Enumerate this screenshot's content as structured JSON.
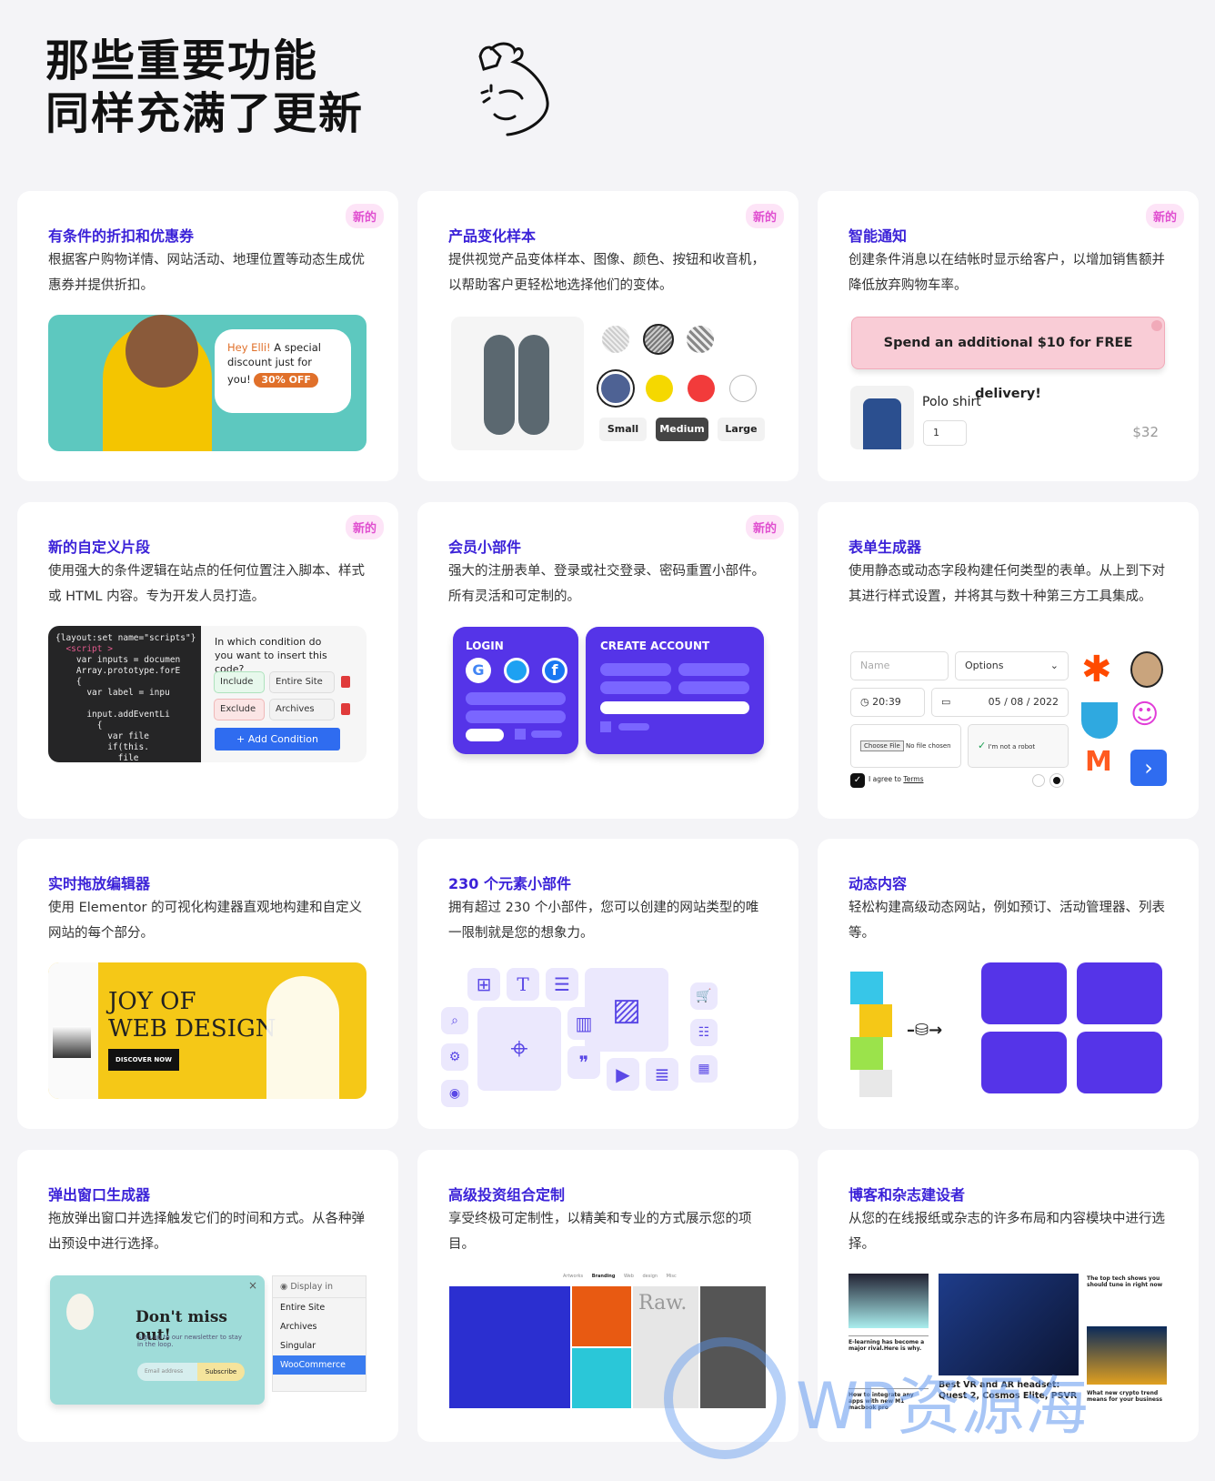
{
  "hero": {
    "line1": "那些重要功能",
    "line2": "同样充满了更新",
    "icon": "flexed-biceps-icon"
  },
  "badge_label": "新的",
  "colors": {
    "accent": "#3b22d8",
    "badge": "#e04fd0",
    "widget_purple": "#5534e8",
    "background": "#f4f4f7"
  },
  "cards": [
    {
      "title": "有条件的折扣和优惠券",
      "desc": "根据客户购物详情、网站活动、地理位置等动态生成优惠券并提供折扣。",
      "new": true,
      "bubble": {
        "name": "Hey Elli!",
        "text": " A special discount just for you!",
        "tag": "30% OFF"
      }
    },
    {
      "title": "产品变化样本",
      "desc": "提供视觉产品变体样本、图像、颜色、按钮和收音机，以帮助客户更轻松地选择他们的变体。",
      "new": true,
      "sizes": [
        "Small",
        "Medium",
        "Large"
      ],
      "selected_size": "Medium",
      "swatch_colors": [
        "#4e6294",
        "#f5d800",
        "#f23b3b",
        "#ffffff"
      ]
    },
    {
      "title": "智能通知",
      "desc": "创建条件消息以在结帐时显示给客户，以增加销售额并降低放弃购物车率。",
      "new": true,
      "notice": "Spend an additional $10 for FREE delivery!",
      "product": "Polo shirt",
      "qty": "1",
      "price": "$32"
    },
    {
      "title": "新的自定义片段",
      "desc": "使用强大的条件逻辑在站点的任何位置注入脚本、样式或 HTML 内容。专为开发人员打造。",
      "new": true,
      "code": [
        "{layout:set name=\"scripts\"}",
        "  <script >",
        "    var inputs = documen",
        "    Array.prototype.forE",
        "    {",
        "      var label = inpu",
        "",
        "      input.addEventLi",
        "        {",
        "          var file",
        "          if(this.",
        "            file"
      ],
      "question": "In which condition do you want to insert this code?",
      "include": "Include",
      "exclude": "Exclude",
      "site1": "Entire Site",
      "site2": "Archives",
      "add": "+ Add Condition"
    },
    {
      "title": "会员小部件",
      "desc": "强大的注册表单、登录或社交登录、密码重置小部件。所有灵活和可定制的。",
      "new": true,
      "login": "LOGIN",
      "create": "CREATE ACCOUNT"
    },
    {
      "title": "表单生成器",
      "desc": "使用静态或动态字段构建任何类型的表单。从上到下对其进行样式设置，并将其与数十种第三方工具集成。",
      "name_placeholder": "Name",
      "options": "Options",
      "time": "20:39",
      "date": "05 / 08 / 2022",
      "choose_file": "Choose File",
      "no_file": "No file chosen",
      "captcha": "I'm not a robot",
      "agree": "I agree to ",
      "terms": "Terms"
    },
    {
      "title": "实时拖放编辑器",
      "desc": "使用 Elementor 的可视化构建器直观地构建和自定义网站的每个部分。",
      "banner1": "JOY OF",
      "banner2": "WEB DESIGN",
      "cta": "DISCOVER NOW"
    },
    {
      "title": "230 个元素小部件",
      "desc": "拥有超过 230 个小部件，您可以创建的网站类型的唯一限制就是您的想象力。"
    },
    {
      "title": "动态内容",
      "desc": "轻松构建高级动态网站，例如预订、活动管理器、列表等。"
    },
    {
      "title": "弹出窗口生成器",
      "desc": "拖放弹出窗口并选择触发它们的时间和方式。从各种弹出预设中进行选择。",
      "popup_title": "Don't miss out!",
      "popup_text": "Sign up to our newsletter to stay in the loop.",
      "email": "Email address",
      "subscribe": "Subscribe",
      "display_in": "Display in",
      "display_options": [
        "Entire Site",
        "Archives",
        "Singular",
        "WooCommerce"
      ],
      "selected": "WooCommerce"
    },
    {
      "title": "高级投资组合定制",
      "desc": "享受终极可定制性，以精美和专业的方式展示您的项目。",
      "filters": [
        "Artworks",
        "Branding",
        "Web design",
        "Misc"
      ],
      "raw": "Raw."
    },
    {
      "title": "博客和杂志建设者",
      "desc": "从您的在线报纸或杂志的许多布局和内容模块中进行选择。",
      "posts": [
        "E-learning has become a major rival.Here is why.",
        "How to integrate any apps with new M1 macbook pro",
        "Best VR and AR headset: Quest 2, Cosmos Elite, PSVR",
        "The top tech shows you should tune in right now",
        "What new crypto trend means for your business"
      ]
    }
  ],
  "watermark": "WP资源海"
}
